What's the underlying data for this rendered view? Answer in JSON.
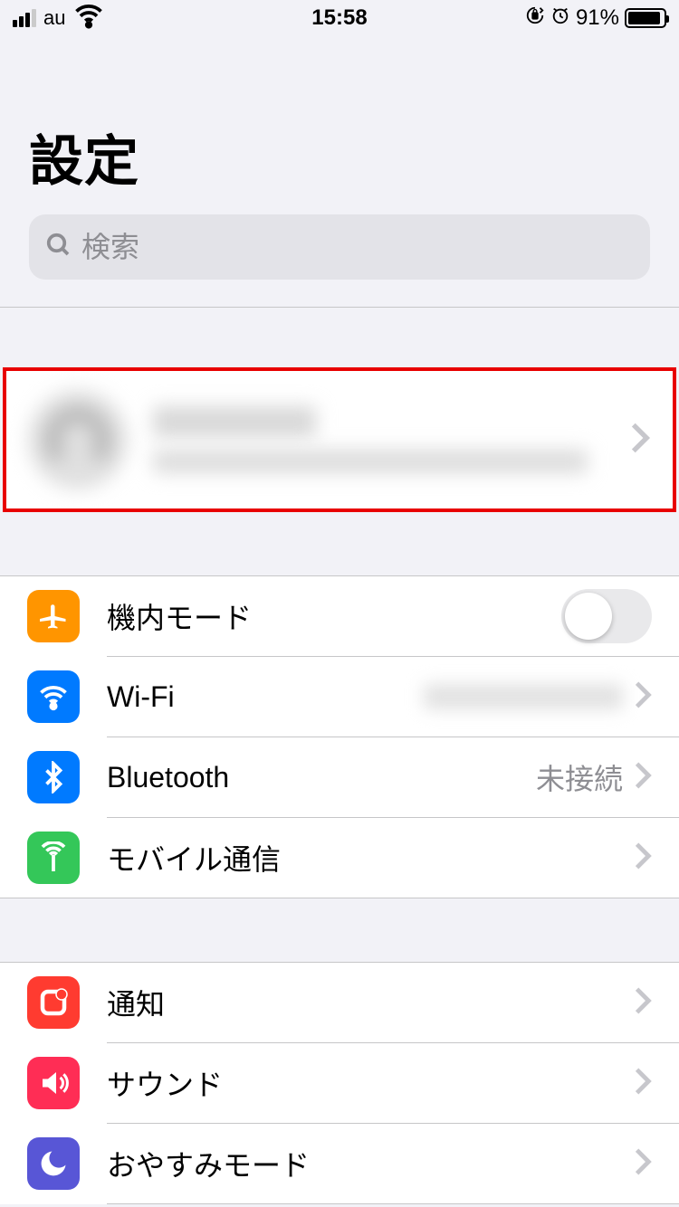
{
  "statusbar": {
    "carrier": "au",
    "time": "15:58",
    "battery_pct": "91%"
  },
  "header": {
    "title": "設定"
  },
  "search": {
    "placeholder": "検索"
  },
  "account": {
    "name_redacted": true,
    "subtitle_redacted": true
  },
  "rows": {
    "airplane": {
      "label": "機内モード",
      "toggle_on": false
    },
    "wifi": {
      "label": "Wi-Fi",
      "value_redacted": true
    },
    "bluetooth": {
      "label": "Bluetooth",
      "value": "未接続"
    },
    "cellular": {
      "label": "モバイル通信"
    },
    "notifications": {
      "label": "通知"
    },
    "sounds": {
      "label": "サウンド"
    },
    "dnd": {
      "label": "おやすみモード"
    }
  }
}
